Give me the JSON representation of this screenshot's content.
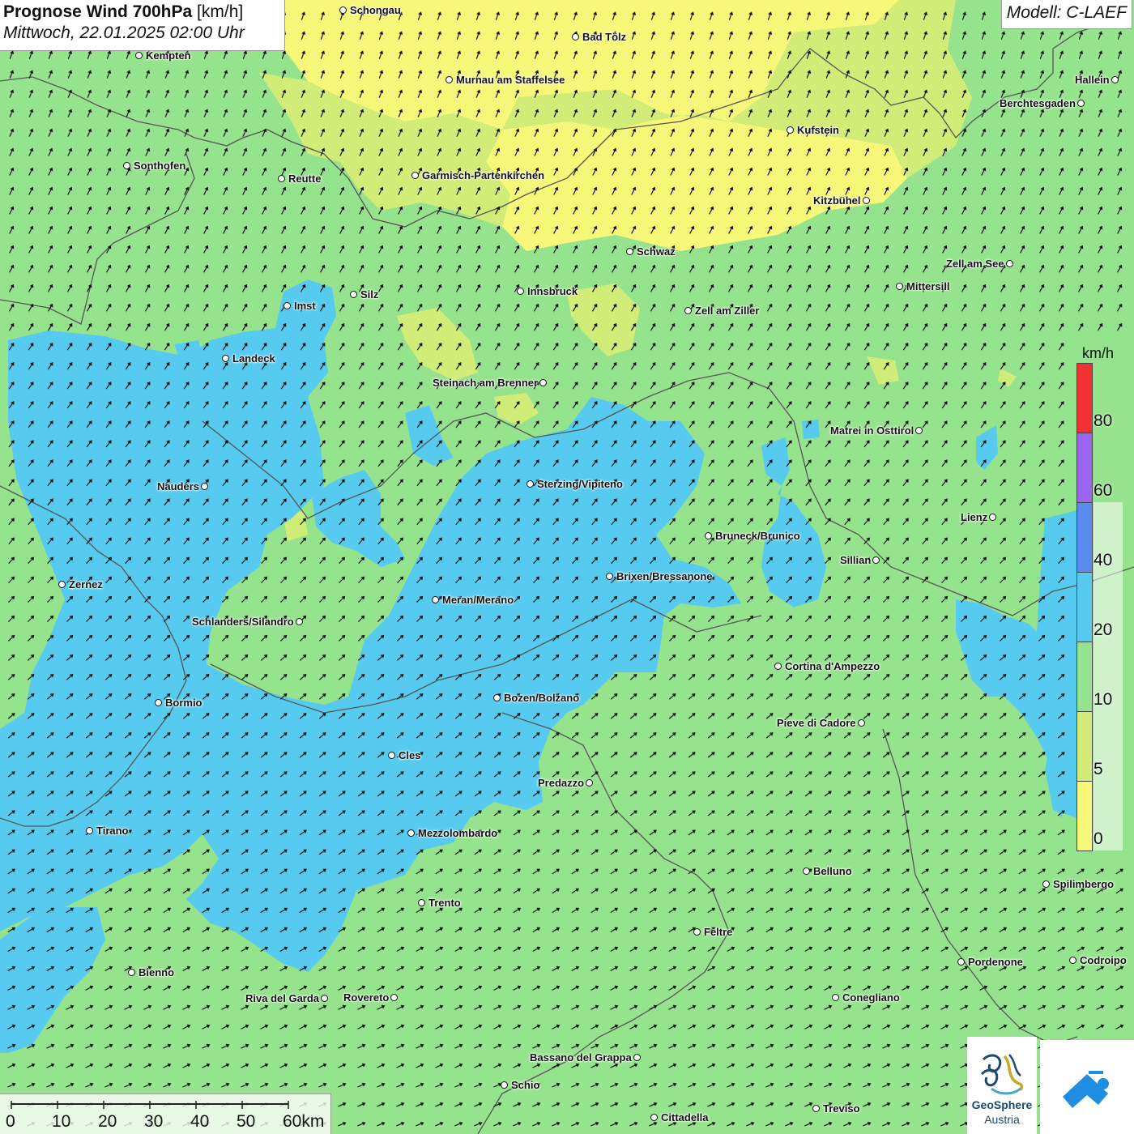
{
  "title": {
    "main": "Prognose Wind 700hPa",
    "unit": "[km/h]",
    "datetime": "Mittwoch, 22.01.2025 02:00 Uhr"
  },
  "model": "Modell: C-LAEF",
  "colors": {
    "zone_0_5": "#f7f77a",
    "zone_5_10": "#d2ec78",
    "zone_10_20": "#96e38d",
    "zone_20_40": "#57cbef",
    "zone_40_60": "#5a8cf0",
    "zone_60_80": "#9966ee",
    "zone_80_plus": "#f03232",
    "arrow": "#111111",
    "border": "#555555"
  },
  "wind_direction": "southwest-to-northeast",
  "cities": [
    {
      "name": "Schongau",
      "label_side": "right"
    },
    {
      "name": "Bad Tölz",
      "label_side": "right"
    },
    {
      "name": "Kempten",
      "label_side": "right"
    },
    {
      "name": "Murnau am Staffelsee",
      "label_side": "right"
    },
    {
      "name": "Hallein",
      "label_side": "left"
    },
    {
      "name": "Berchtesgaden",
      "label_side": "left"
    },
    {
      "name": "Kufstein",
      "label_side": "right"
    },
    {
      "name": "Sonthofen",
      "label_side": "right"
    },
    {
      "name": "Reutte",
      "label_side": "right"
    },
    {
      "name": "Garmisch-Partenkirchen",
      "label_side": "right"
    },
    {
      "name": "Kitzbühel",
      "label_side": "left"
    },
    {
      "name": "Schwaz",
      "label_side": "right"
    },
    {
      "name": "Zell am See",
      "label_side": "left"
    },
    {
      "name": "Mittersill",
      "label_side": "right"
    },
    {
      "name": "Innsbruck",
      "label_side": "right"
    },
    {
      "name": "Silz",
      "label_side": "right"
    },
    {
      "name": "Imst",
      "label_side": "right"
    },
    {
      "name": "Zell am Ziller",
      "label_side": "right"
    },
    {
      "name": "Landeck",
      "label_side": "right"
    },
    {
      "name": "Steinach am Brenner",
      "label_side": "left"
    },
    {
      "name": "Matrei in Osttirol",
      "label_side": "left"
    },
    {
      "name": "Nauders",
      "label_side": "left"
    },
    {
      "name": "Sterzing/Vipiteno",
      "label_side": "right"
    },
    {
      "name": "Lienz",
      "label_side": "left"
    },
    {
      "name": "Bruneck/Brunico",
      "label_side": "right"
    },
    {
      "name": "Sillian",
      "label_side": "left"
    },
    {
      "name": "Brixen/Bressanone",
      "label_side": "right"
    },
    {
      "name": "Zernez",
      "label_side": "right"
    },
    {
      "name": "Meran/Merano",
      "label_side": "right"
    },
    {
      "name": "Schlanders/Silandro",
      "label_side": "left"
    },
    {
      "name": "Cortina d'Ampezzo",
      "label_side": "right"
    },
    {
      "name": "Bozen/Bolzano",
      "label_side": "right"
    },
    {
      "name": "Bormio",
      "label_side": "right"
    },
    {
      "name": "Pieve di Cadore",
      "label_side": "left"
    },
    {
      "name": "Cles",
      "label_side": "right"
    },
    {
      "name": "Predazzo",
      "label_side": "left"
    },
    {
      "name": "Tirano",
      "label_side": "right"
    },
    {
      "name": "Mezzolombardo",
      "label_side": "right"
    },
    {
      "name": "Belluno",
      "label_side": "right"
    },
    {
      "name": "Spilimbergo",
      "label_side": "right"
    },
    {
      "name": "Trento",
      "label_side": "right"
    },
    {
      "name": "Feltre",
      "label_side": "right"
    },
    {
      "name": "Pordenone",
      "label_side": "right"
    },
    {
      "name": "Codroipo",
      "label_side": "right"
    },
    {
      "name": "Bienno",
      "label_side": "right"
    },
    {
      "name": "Riva del Garda",
      "label_side": "left"
    },
    {
      "name": "Rovereto",
      "label_side": "left"
    },
    {
      "name": "Conegliano",
      "label_side": "right"
    },
    {
      "name": "Bassano del Grappa",
      "label_side": "left"
    },
    {
      "name": "Schio",
      "label_side": "right"
    },
    {
      "name": "Treviso",
      "label_side": "right"
    },
    {
      "name": "Cittadella",
      "label_side": "right"
    }
  ],
  "legend": {
    "unit": "km/h",
    "bins": [
      {
        "from": 0,
        "to": 5,
        "color": "#f7f77a"
      },
      {
        "from": 5,
        "to": 10,
        "color": "#d2ec78"
      },
      {
        "from": 10,
        "to": 20,
        "color": "#96e38d"
      },
      {
        "from": 20,
        "to": 40,
        "color": "#57cbef"
      },
      {
        "from": 40,
        "to": 60,
        "color": "#5a8cf0"
      },
      {
        "from": 60,
        "to": 80,
        "color": "#9966ee"
      },
      {
        "from": 80,
        "to": null,
        "color": "#f03232"
      }
    ],
    "ticks": [
      "0",
      "5",
      "10",
      "20",
      "40",
      "60",
      "80"
    ]
  },
  "scalebar": {
    "labels": [
      "0",
      "10",
      "20",
      "30",
      "40",
      "50",
      "60km"
    ]
  },
  "logos": {
    "geosphere_line1": "GeoSphere",
    "geosphere_line2": "Austria",
    "geosphere_icon": "geosphere-logo-icon",
    "app_icon": "wind-app-logo-icon"
  }
}
